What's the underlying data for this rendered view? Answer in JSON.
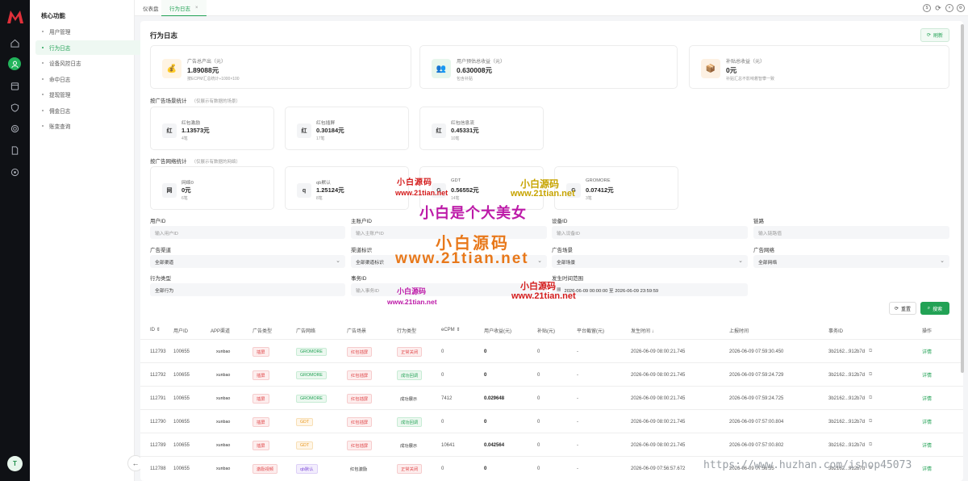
{
  "menu": {
    "title": "核心功能",
    "items": [
      "用户管理",
      "行为日志",
      "设备风控日志",
      "命中日志",
      "提现管理",
      "佣金日志",
      "账变查询"
    ]
  },
  "user": {
    "avatar": "T"
  },
  "tabs": [
    {
      "label": "仪表盘"
    },
    {
      "label": "行为日志"
    }
  ],
  "page": {
    "title": "行为日志",
    "refresh": "刷新"
  },
  "summary": [
    {
      "icon": "money-bag-icon",
      "glyph": "💰",
      "label": "广告总产出（元）",
      "value": "1.89088元",
      "sub": "按ECPM汇总统计÷1000×100",
      "bg": "#fff4e3"
    },
    {
      "icon": "users-icon",
      "glyph": "👥",
      "label": "用户预估总收益（元）",
      "value": "0.630008元",
      "sub": "包含补贴",
      "bg": "#e7f6ec"
    },
    {
      "icon": "box-icon",
      "glyph": "📦",
      "label": "补贴总收益（元）",
      "value": "0元",
      "sub": "补贴汇总不影响着智攀一致",
      "bg": "#fdf1e3"
    }
  ],
  "scene_section": {
    "title": "按广告场景统计",
    "hint": "（仅展示有数据的场景）"
  },
  "scene_cards": [
    {
      "glyph": "红",
      "label": "红包激励",
      "value": "1.13573元",
      "sub": "4笔"
    },
    {
      "glyph": "红",
      "label": "红包插屏",
      "value": "0.30184元",
      "sub": "17笔"
    },
    {
      "glyph": "红",
      "label": "红包信息流",
      "value": "0.45331元",
      "sub": "10笔"
    }
  ],
  "network_section": {
    "title": "按广告网络统计",
    "hint": "（仅展示有数据的网络）"
  },
  "network_cards": [
    {
      "glyph": "网",
      "label": "网络0",
      "value": "0元",
      "sub": "6笔"
    },
    {
      "glyph": "q",
      "label": "qb默认",
      "value": "1.25124元",
      "sub": "8笔"
    },
    {
      "glyph": "G",
      "label": "GDT",
      "value": "0.56552元",
      "sub": "14笔"
    },
    {
      "glyph": "G",
      "label": "GROMORE",
      "value": "0.07412元",
      "sub": "3笔"
    }
  ],
  "filters": {
    "user_id": {
      "label": "用户ID",
      "placeholder": "输入用户ID"
    },
    "main_account": {
      "label": "主账户ID",
      "placeholder": "输入主账户ID"
    },
    "device_id": {
      "label": "设备ID",
      "placeholder": "输入设备ID"
    },
    "channel_link": {
      "label": "链路",
      "placeholder": "输入链路值"
    },
    "ad_channel": {
      "label": "广告渠道",
      "value": "全部渠道"
    },
    "channel_tag": {
      "label": "渠道标识",
      "value": "全部渠道标识"
    },
    "ad_scene": {
      "label": "广告场景",
      "value": "全部场景"
    },
    "ad_network": {
      "label": "广告网络",
      "value": "全部网络"
    },
    "action_type": {
      "label": "行为类型",
      "value": "全部行为"
    },
    "event_id": {
      "label": "事务ID",
      "placeholder": "输入事务ID"
    },
    "time_range": {
      "label": "发生时间范围",
      "value": "2026-06-09 00:00:00 至 2026-06-09 23:59:59"
    },
    "reset": "重置",
    "search": "搜索"
  },
  "columns": [
    "ID",
    "用户ID",
    "APP渠道",
    "广告类型",
    "广告网络",
    "广告场景",
    "行为类型",
    "eCPM",
    "用户收益(元)",
    "补贴(元)",
    "平台截留(元)",
    "发生时间",
    "上报时间",
    "事务ID",
    "操作"
  ],
  "rows": [
    {
      "id": "112793",
      "uid": "100655",
      "app": "xunbao",
      "adtype": "插屏",
      "adtype_c": "red",
      "net": "GROMORE",
      "net_c": "green",
      "scene": "红包插屏",
      "scene_c": "red",
      "action": "正常关闭",
      "action_c": "red",
      "ecpm": "0",
      "income": "0",
      "subsidy": "0",
      "keep": "-",
      "occur": "2026-06-09 08:00:21.745",
      "report": "2026-06-09 07:59:30.450",
      "tx": "3b2162...912b7d",
      "op": "详情"
    },
    {
      "id": "112792",
      "uid": "100655",
      "app": "xunbao",
      "adtype": "插屏",
      "adtype_c": "red",
      "net": "GROMORE",
      "net_c": "green",
      "scene": "红包插屏",
      "scene_c": "red",
      "action": "成功回调",
      "action_c": "green",
      "ecpm": "0",
      "income": "0",
      "subsidy": "0",
      "keep": "-",
      "occur": "2026-06-09 08:00:21.745",
      "report": "2026-06-09 07:59:24.729",
      "tx": "3b2162...912b7d",
      "op": "详情"
    },
    {
      "id": "112791",
      "uid": "100655",
      "app": "xunbao",
      "adtype": "插屏",
      "adtype_c": "red",
      "net": "GROMORE",
      "net_c": "green",
      "scene": "红包插屏",
      "scene_c": "red",
      "action": "成功展示",
      "action_c": "plain",
      "ecpm": "7412",
      "income": "0.029648",
      "subsidy": "0",
      "keep": "-",
      "occur": "2026-06-09 08:00:21.745",
      "report": "2026-06-09 07:59:24.725",
      "tx": "3b2162...912b7d",
      "op": "详情"
    },
    {
      "id": "112790",
      "uid": "100655",
      "app": "xunbao",
      "adtype": "插屏",
      "adtype_c": "red",
      "net": "GDT",
      "net_c": "orange",
      "scene": "红包插屏",
      "scene_c": "red",
      "action": "成功回调",
      "action_c": "green",
      "ecpm": "0",
      "income": "0",
      "subsidy": "0",
      "keep": "-",
      "occur": "2026-06-09 08:00:21.745",
      "report": "2026-06-09 07:57:00.804",
      "tx": "3b2162...912b7d",
      "op": "详情"
    },
    {
      "id": "112789",
      "uid": "100655",
      "app": "xunbao",
      "adtype": "插屏",
      "adtype_c": "red",
      "net": "GDT",
      "net_c": "orange",
      "scene": "红包插屏",
      "scene_c": "red",
      "action": "成功展示",
      "action_c": "plain",
      "ecpm": "10641",
      "income": "0.042564",
      "subsidy": "0",
      "keep": "-",
      "occur": "2026-06-09 08:00:21.745",
      "report": "2026-06-09 07:57:00.802",
      "tx": "3b2162...912b7d",
      "op": "详情"
    },
    {
      "id": "112788",
      "uid": "100655",
      "app": "xunbao",
      "adtype": "激励视频",
      "adtype_c": "red",
      "net": "qb默认",
      "net_c": "purple",
      "scene": "红包激励",
      "scene_c": "plain",
      "action": "正常关闭",
      "action_c": "red",
      "ecpm": "0",
      "income": "0",
      "subsidy": "0",
      "keep": "-",
      "occur": "2026-06-09 07:56:57.672",
      "report": "2026-06-09 07:56:55",
      "tx": "3b2162...912b7d",
      "op": "详情"
    }
  ],
  "watermarks": [
    "小白源码",
    "www.21tian.net",
    "小白源码",
    "www.21tian.net",
    "小白是个大美女",
    "小白源码",
    "www.21tian.net",
    "小白源码",
    "www.21tian.net",
    "小白源码",
    "www.21tian.net",
    "https://www.huzhan.com/ishop45073"
  ],
  "colors": {
    "accent": "#22a255",
    "rail": "#0f1115"
  }
}
